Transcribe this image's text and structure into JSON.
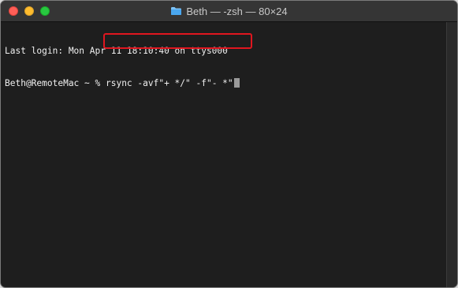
{
  "window": {
    "title": "Beth — -zsh — 80×24",
    "title_icon": "folder-icon",
    "traffic_lights": {
      "close_color": "#ff5f57",
      "minimize_color": "#febc2e",
      "zoom_color": "#28c840"
    }
  },
  "terminal": {
    "last_login": "Last login: Mon Apr 11 18:10:40 on ttys000",
    "prompt": "Beth@RemoteMac ~ % ",
    "command": "rsync -avf\"+ */\" -f\"- *\"",
    "highlight_color": "#e0161f"
  }
}
